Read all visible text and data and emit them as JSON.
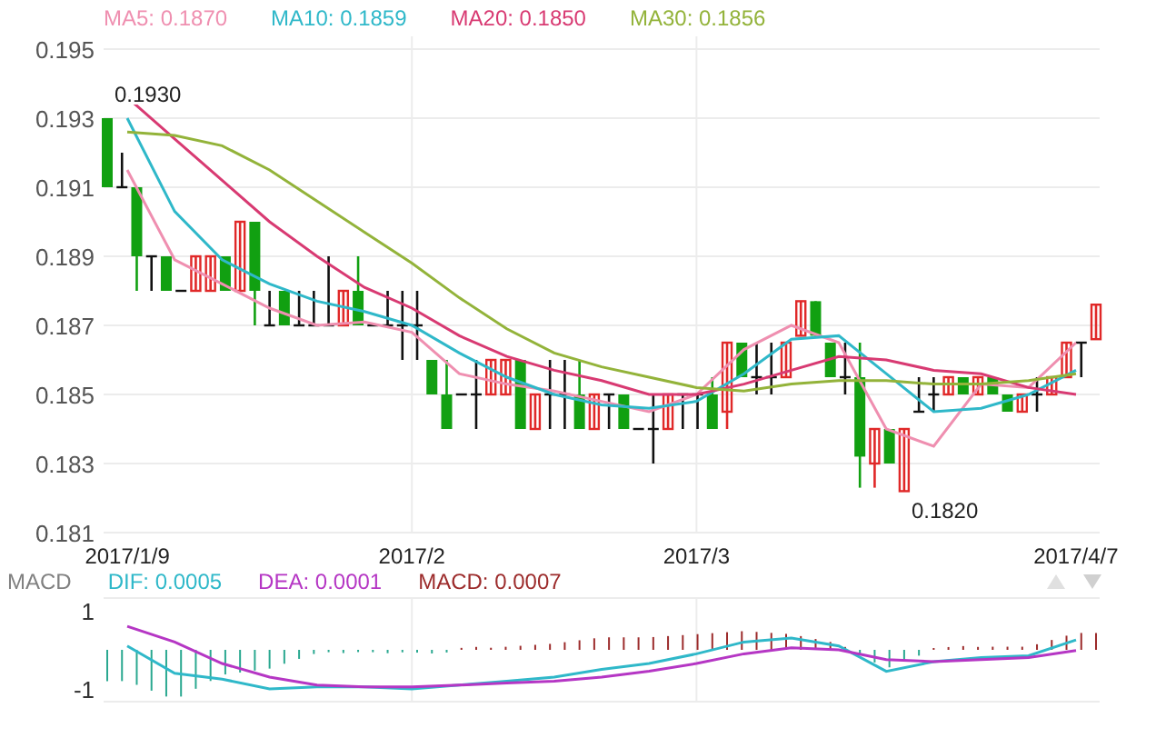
{
  "price_chart": {
    "chart_data": {
      "type": "line",
      "grid": true,
      "ylim": [
        0.181,
        0.195
      ],
      "categories": [
        "2017/1/9",
        null,
        null,
        null,
        null,
        null,
        "2017/2",
        null,
        null,
        null,
        null,
        null,
        "2017/3",
        null,
        null,
        null,
        null,
        null,
        null,
        null,
        "2017/4/7"
      ],
      "series": [
        {
          "name": "MA5: 0.1870",
          "color": "#ef8fb0",
          "values": [
            0.1915,
            0.1889,
            0.1882,
            0.1875,
            0.187,
            0.1871,
            0.1868,
            0.1856,
            0.1853,
            0.1851,
            0.1848,
            0.1845,
            0.185,
            0.1863,
            0.187,
            0.1865,
            0.184,
            0.1835,
            0.1853,
            0.1852,
            0.1865
          ]
        },
        {
          "name": "MA10: 0.1859",
          "color": "#2fb8c9",
          "values": [
            0.193,
            0.1903,
            0.1889,
            0.1882,
            0.1877,
            0.1874,
            0.187,
            0.1862,
            0.1855,
            0.185,
            0.1847,
            0.1846,
            0.1848,
            0.1856,
            0.1866,
            0.1867,
            0.1856,
            0.1845,
            0.1846,
            0.185,
            0.1857
          ]
        },
        {
          "name": "MA20: 0.1850",
          "color": "#d83a72",
          "values": [
            0.1936,
            0.1924,
            0.1912,
            0.19,
            0.189,
            0.1881,
            0.1875,
            0.1867,
            0.1861,
            0.1857,
            0.1854,
            0.185,
            0.185,
            0.1853,
            0.1857,
            0.1861,
            0.186,
            0.1857,
            0.1856,
            0.1852,
            0.185
          ]
        },
        {
          "name": "MA30: 0.1856",
          "color": "#93b33a",
          "values": [
            0.1926,
            0.1925,
            0.1922,
            0.1915,
            0.1906,
            0.1897,
            0.1888,
            0.1878,
            0.1869,
            0.1862,
            0.1858,
            0.1855,
            0.1852,
            0.1851,
            0.1853,
            0.1854,
            0.1854,
            0.1853,
            0.1853,
            0.1854,
            0.1856
          ]
        }
      ],
      "yticks": [
        {
          "value": 0.195,
          "label": "0.195"
        },
        {
          "value": 0.193,
          "label": "0.193"
        },
        {
          "value": 0.191,
          "label": "0.191"
        },
        {
          "value": 0.189,
          "label": "0.189"
        },
        {
          "value": 0.187,
          "label": "0.187"
        },
        {
          "value": 0.185,
          "label": "0.185"
        },
        {
          "value": 0.183,
          "label": "0.183"
        },
        {
          "value": 0.181,
          "label": "0.181"
        }
      ],
      "annotations": [
        "0.1930",
        "0.1820"
      ]
    }
  },
  "macd_chart": {
    "label": "MACD",
    "histogram_label": {
      "text": "MACD: 0.0007",
      "color": "#9c2b2b"
    },
    "chart_data": {
      "type": "line",
      "grid": true,
      "ylim": [
        -1,
        1
      ],
      "categories": [
        null,
        null,
        null,
        null,
        null,
        null,
        null,
        null,
        null,
        null,
        null,
        null,
        null,
        null,
        null,
        null,
        null,
        null,
        null,
        null,
        null
      ],
      "series": [
        {
          "name": "DIF: 0.0005",
          "color": "#2fb8c9",
          "values": [
            0.1,
            -0.6,
            -0.75,
            -1.0,
            -0.95,
            -0.95,
            -1.0,
            -0.9,
            -0.8,
            -0.7,
            -0.5,
            -0.35,
            -0.1,
            0.2,
            0.3,
            0.1,
            -0.55,
            -0.3,
            -0.2,
            -0.15,
            0.25
          ]
        },
        {
          "name": "DEA: 0.0001",
          "color": "#b536c4",
          "values": [
            0.6,
            0.2,
            -0.35,
            -0.7,
            -0.9,
            -0.95,
            -0.95,
            -0.9,
            -0.85,
            -0.8,
            -0.7,
            -0.55,
            -0.35,
            -0.1,
            0.05,
            0.0,
            -0.25,
            -0.3,
            -0.25,
            -0.2,
            -0.02
          ]
        }
      ],
      "yticks": [
        {
          "value": 1,
          "label": "1"
        },
        {
          "value": -1,
          "label": "-1"
        }
      ]
    }
  }
}
